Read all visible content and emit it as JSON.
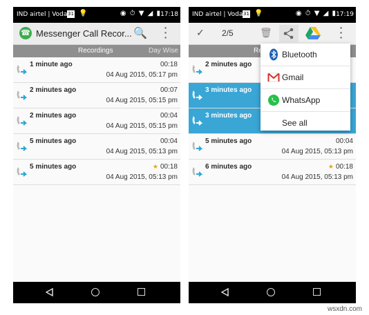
{
  "status_left": {
    "carrier": "IND airtel | Vodaf",
    "date_badge": "31",
    "time": "17:18"
  },
  "status_right": {
    "carrier": "IND airtel | Vodaf",
    "date_badge": "31",
    "time": "17:19"
  },
  "left_app": {
    "title": "Messenger Call Recor...",
    "tabs": [
      "Recordings",
      "Day Wise"
    ],
    "rows": [
      {
        "ago": "1 minute ago",
        "duration": "00:18",
        "timestamp": "04 Aug 2015, 05:17 pm",
        "starred": false
      },
      {
        "ago": "2 minutes ago",
        "duration": "00:07",
        "timestamp": "04 Aug 2015, 05:15 pm",
        "starred": false
      },
      {
        "ago": "2 minutes ago",
        "duration": "00:04",
        "timestamp": "04 Aug 2015, 05:15 pm",
        "starred": false
      },
      {
        "ago": "5 minutes ago",
        "duration": "00:04",
        "timestamp": "04 Aug 2015, 05:13 pm",
        "starred": false
      },
      {
        "ago": "5 minutes ago",
        "duration": "00:18",
        "timestamp": "04 Aug 2015, 05:13 pm",
        "starred": true
      }
    ]
  },
  "right_app": {
    "selection_count": "2/5",
    "tab_partial": "Rec",
    "rows": [
      {
        "ago": "2 minutes ago",
        "duration": "",
        "timestamp": "",
        "selected": false,
        "starred": false
      },
      {
        "ago": "3 minutes ago",
        "duration": "",
        "timestamp": "",
        "selected": true,
        "starred": false
      },
      {
        "ago": "3 minutes ago",
        "duration": "",
        "timestamp": "",
        "selected": true,
        "starred": false
      },
      {
        "ago": "5 minutes ago",
        "duration": "00:04",
        "timestamp": "04 Aug 2015, 05:13 pm",
        "selected": false,
        "starred": false
      },
      {
        "ago": "6 minutes ago",
        "duration": "00:18",
        "timestamp": "04 Aug 2015, 05:13 pm",
        "selected": false,
        "starred": true
      }
    ],
    "share_menu": [
      {
        "label": "Bluetooth",
        "icon": "bluetooth-icon"
      },
      {
        "label": "Gmail",
        "icon": "gmail-icon"
      },
      {
        "label": "WhatsApp",
        "icon": "whatsapp-icon"
      },
      {
        "label": "See all",
        "icon": ""
      }
    ]
  },
  "colors": {
    "selected_row": "#39a6d6",
    "tab_bar": "#8f8f8f",
    "star": "#e0a51c",
    "app_logo": "#3cae4d"
  },
  "watermark": "wsxdn.com"
}
